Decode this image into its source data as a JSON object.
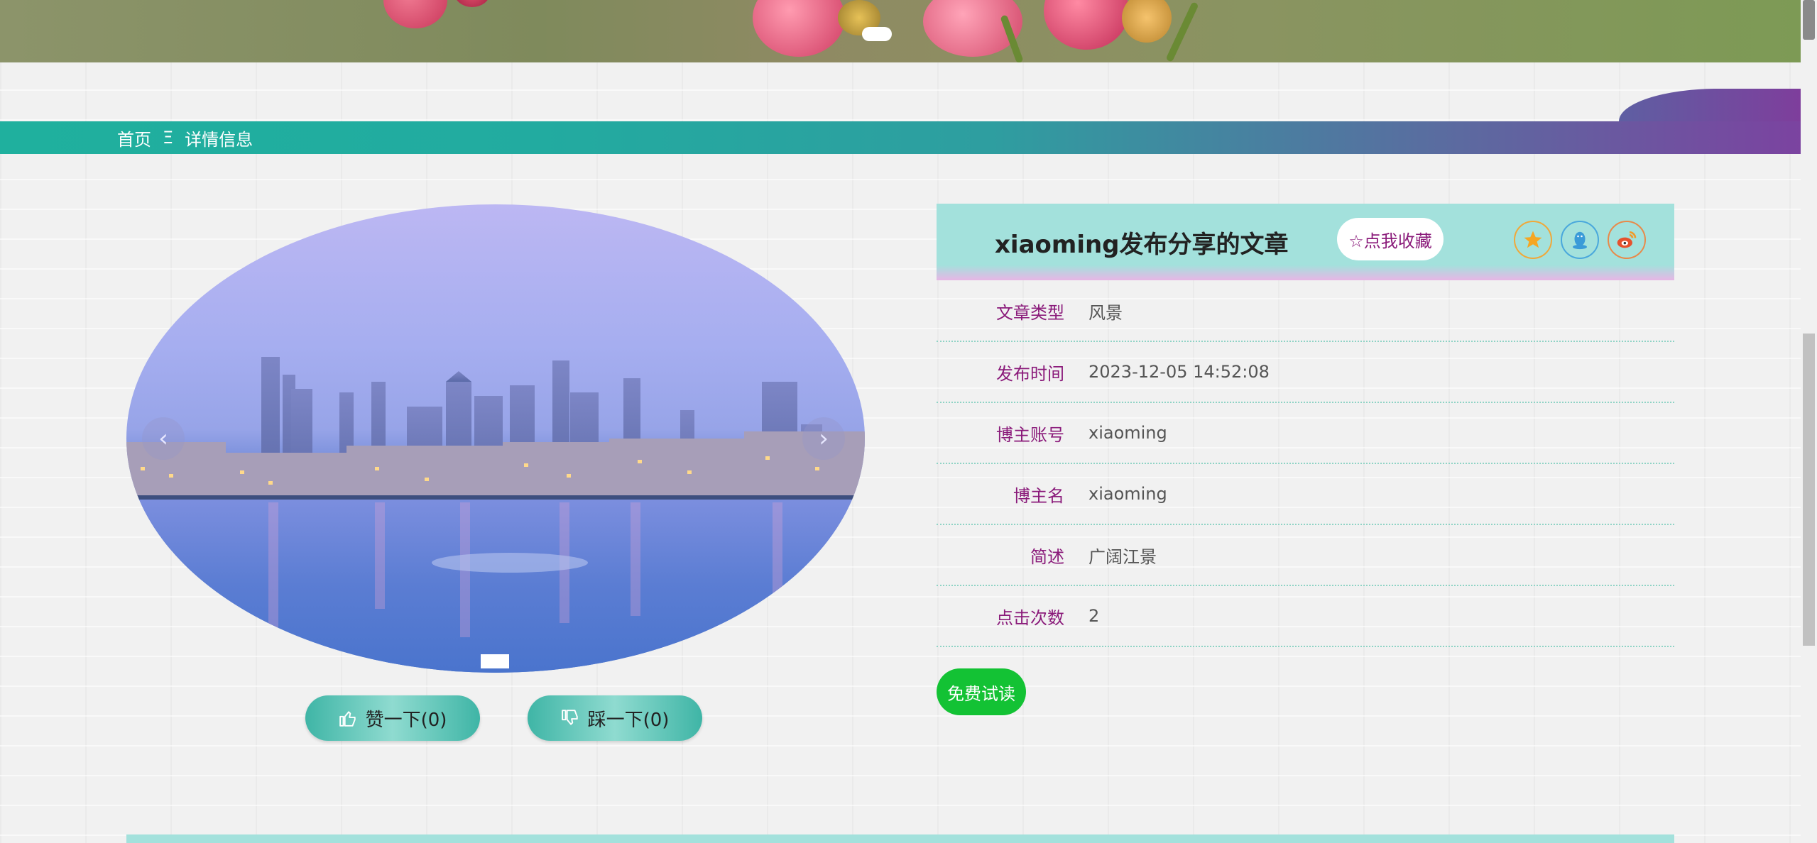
{
  "breadcrumb": {
    "home": "首页",
    "separator": "Ξ",
    "current": "详情信息"
  },
  "detail": {
    "title": "xiaoming发布分享的文章",
    "collect_label": "☆点我收藏",
    "fields": [
      {
        "label": "文章类型",
        "value": "风景"
      },
      {
        "label": "发布时间",
        "value": "2023-12-05 14:52:08"
      },
      {
        "label": "博主账号",
        "value": "xiaoming"
      },
      {
        "label": "博主名",
        "value": "xiaoming"
      },
      {
        "label": "简述",
        "value": "广阔江景"
      },
      {
        "label": "点击次数",
        "value": "2"
      }
    ],
    "trial_label": "免费试读"
  },
  "votes": {
    "like_label": "赞一下(0)",
    "dislike_label": "踩一下(0)"
  },
  "carousel": {
    "prev": "‹",
    "next": "›"
  },
  "colors": {
    "accent_teal": "#22ab9f",
    "accent_purple": "#7b43a0",
    "label_purple": "#8a1a7a",
    "trial_green": "#13c234"
  }
}
